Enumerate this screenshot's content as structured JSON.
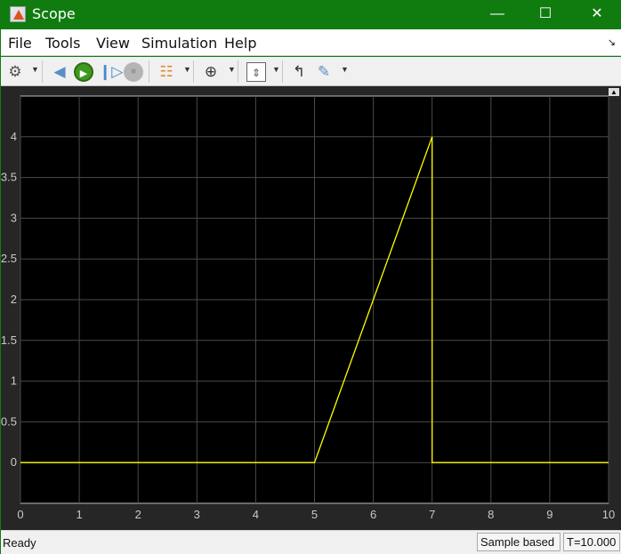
{
  "window": {
    "title": "Scope"
  },
  "menu": [
    "File",
    "Tools",
    "View",
    "Simulation",
    "Help"
  ],
  "toolbar": [
    "settings-icon",
    "step-back-icon",
    "run-icon",
    "step-forward-icon",
    "stop-icon",
    "signal-highlight-icon",
    "zoom-in-icon",
    "autoscale-icon",
    "triggers-icon",
    "measurements-icon"
  ],
  "status": {
    "left": "Ready",
    "mode": "Sample based",
    "time": "T=10.000"
  },
  "chart_data": {
    "type": "line",
    "xlim": [
      0,
      10
    ],
    "ylim": [
      -0.5,
      4.5
    ],
    "xticks": [
      "0",
      "1",
      "2",
      "3",
      "4",
      "5",
      "6",
      "7",
      "8",
      "9",
      "10"
    ],
    "yticks": [
      "0",
      "0.5",
      "1",
      "1.5",
      "2",
      "2.5",
      "3",
      "3.5",
      "4"
    ],
    "grid": true,
    "series": [
      {
        "color": "#ffff00",
        "x": [
          0,
          5,
          7,
          7,
          10
        ],
        "y": [
          0,
          0,
          4,
          0,
          0
        ]
      }
    ]
  }
}
